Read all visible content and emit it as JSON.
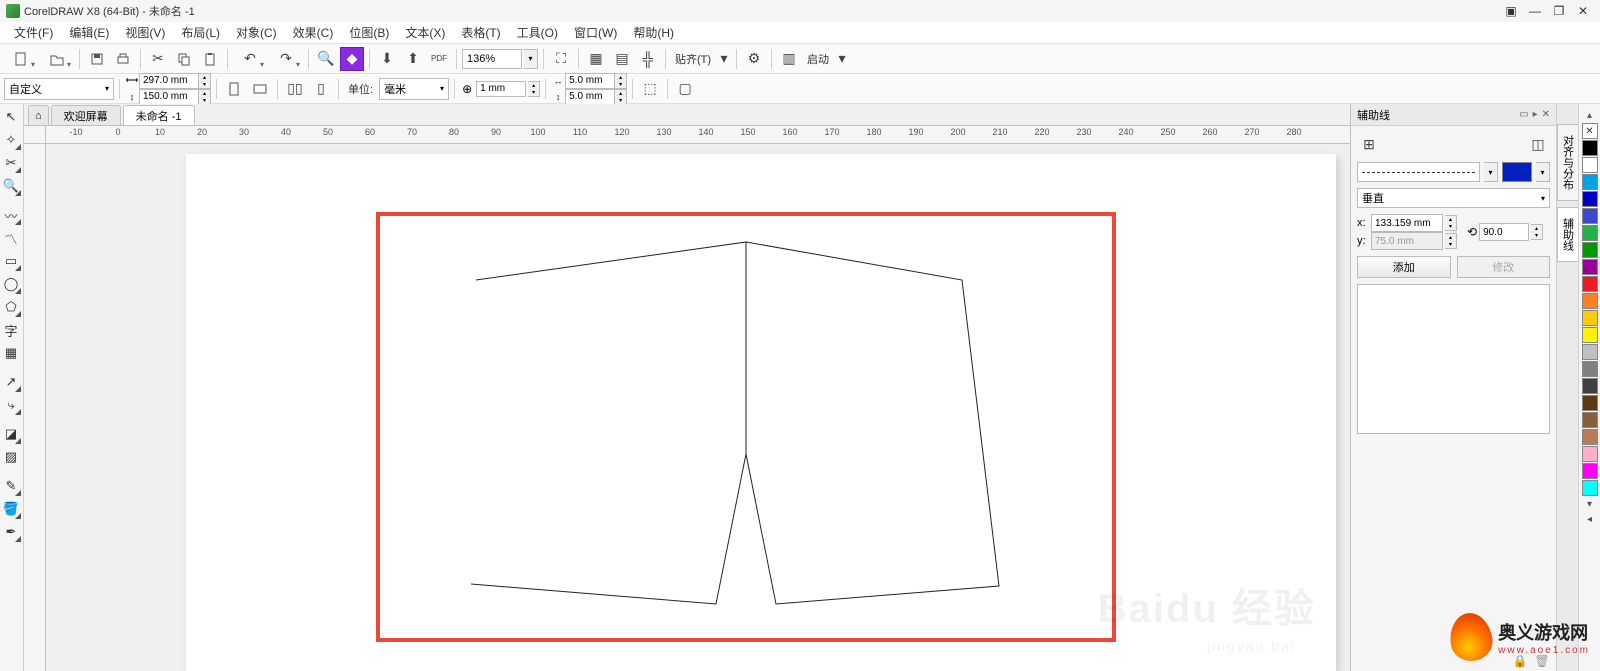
{
  "title": "CorelDRAW X8 (64-Bit) - 未命名 -1",
  "menus": [
    "文件(F)",
    "编辑(E)",
    "视图(V)",
    "布局(L)",
    "对象(C)",
    "效果(C)",
    "位图(B)",
    "文本(X)",
    "表格(T)",
    "工具(O)",
    "窗口(W)",
    "帮助(H)"
  ],
  "toolbar2": {
    "page_preset": "自定义",
    "width": "297.0 mm",
    "height": "150.0 mm",
    "units_label": "单位:",
    "units": "毫米",
    "nudge": "1 mm",
    "dupx": "5.0 mm",
    "dupy": "5.0 mm"
  },
  "zoom": "136%",
  "snap_label": "贴齐(T)",
  "launch_label": "启动",
  "tabs": {
    "welcome": "欢迎屏幕",
    "doc": "未命名 -1"
  },
  "ruler_ticks": [
    -10,
    0,
    10,
    20,
    30,
    40,
    50,
    60,
    70,
    80,
    90,
    100,
    110,
    120,
    130,
    140,
    150,
    160,
    170,
    180,
    190,
    200,
    210,
    220,
    230,
    240,
    250,
    260,
    270,
    280
  ],
  "docker": {
    "title": "辅助线",
    "section": "垂直",
    "x_label": "x:",
    "x": "133.159 mm",
    "y_label": "y:",
    "y": "75.0 mm",
    "angle": "90.0",
    "add": "添加",
    "modify": "修改"
  },
  "vtabs": [
    "对齐与分布",
    "辅助线"
  ],
  "palette_colors": [
    "#000000",
    "#ffffff",
    "#00a2e8",
    "#0000c0",
    "#3f48cc",
    "#22b14c",
    "#009900",
    "#990099",
    "#ed1c24",
    "#ff7f27",
    "#ffc90e",
    "#fff200",
    "#c0c0c0",
    "#808080",
    "#404040",
    "#603913",
    "#8a5d3b",
    "#b97a57",
    "#ffaec9",
    "#ff00ff",
    "#00ffff"
  ],
  "corner_logo": {
    "title": "奥义游戏网",
    "url": "www.aoe1.com"
  },
  "watermark": {
    "brand": "Baidu 经验",
    "sub": "jingyan.bai"
  }
}
